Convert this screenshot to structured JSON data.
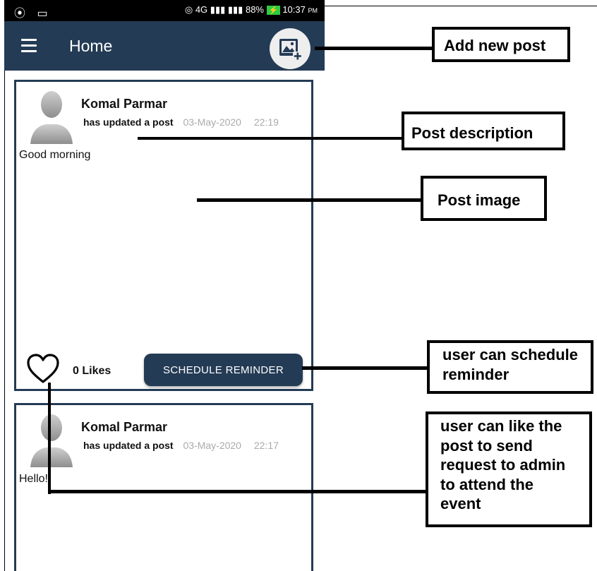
{
  "status_bar": {
    "left_icons": "⦿ ▭",
    "network": "◎ 4G",
    "signal": "▮▮▮ ▮▮▮",
    "battery_percent": "88%",
    "battery_icon": "⚡",
    "time": "10:37",
    "am_pm": "PM"
  },
  "app_bar": {
    "title": "Home"
  },
  "posts": [
    {
      "author": "Komal Parmar",
      "action": "has updated a post",
      "date": "03-May-2020",
      "time": "22:19",
      "text": "Good morning",
      "likes_label": "0 Likes",
      "schedule_label": "SCHEDULE REMINDER"
    },
    {
      "author": "Komal Parmar",
      "action": "has updated a post",
      "date": "03-May-2020",
      "time": "22:17",
      "text": "Hello!"
    }
  ],
  "annotations": {
    "add_post": "Add new post",
    "post_description": "Post description",
    "post_image": "Post image",
    "schedule_line1": "user can schedule",
    "schedule_line2": "reminder",
    "like_line1": "user can like the",
    "like_line2": "post to send",
    "like_line3": "request to admin",
    "like_line4": "to attend the",
    "like_line5": "event"
  },
  "colors": {
    "primary": "#243b55",
    "status_bar": "#000000",
    "muted_text": "#aaaaaa",
    "battery": "#2ecc40"
  }
}
